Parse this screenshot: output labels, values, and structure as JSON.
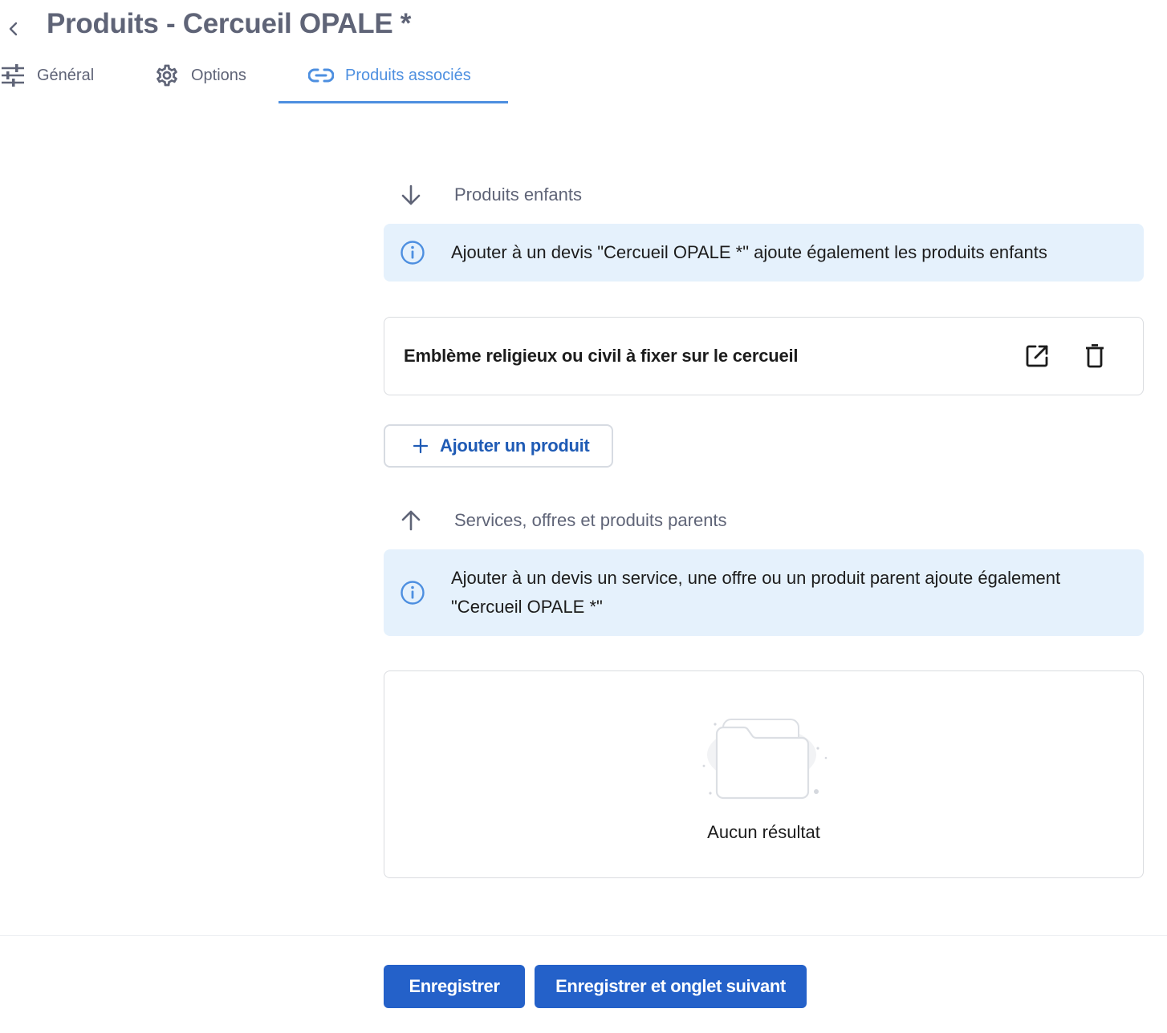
{
  "header": {
    "title": "Produits - Cercueil OPALE *"
  },
  "tabs": [
    {
      "label": "Général",
      "icon": "sliders-icon",
      "active": false
    },
    {
      "label": "Options",
      "icon": "gear-icon",
      "active": false
    },
    {
      "label": "Produits associés",
      "icon": "link-icon",
      "active": true
    }
  ],
  "children_section": {
    "title": "Produits enfants",
    "info": "Ajouter à un devis \"Cercueil OPALE *\" ajoute également les produits enfants",
    "items": [
      {
        "name": "Emblème religieux ou civil à fixer sur le cercueil"
      }
    ],
    "add_button": "Ajouter un produit"
  },
  "parents_section": {
    "title": "Services, offres et produits parents",
    "info": "Ajouter à un devis un service, une offre ou un produit parent ajoute également \"Cercueil OPALE *\"",
    "empty_text": "Aucun résultat"
  },
  "footer": {
    "save_label": "Enregistrer",
    "save_next_label": "Enregistrer et onglet suivant"
  },
  "colors": {
    "accent": "#4d8fe0",
    "primary_button": "#2461c9",
    "info_background": "#e5f1fc",
    "muted_text": "#5f6477"
  }
}
